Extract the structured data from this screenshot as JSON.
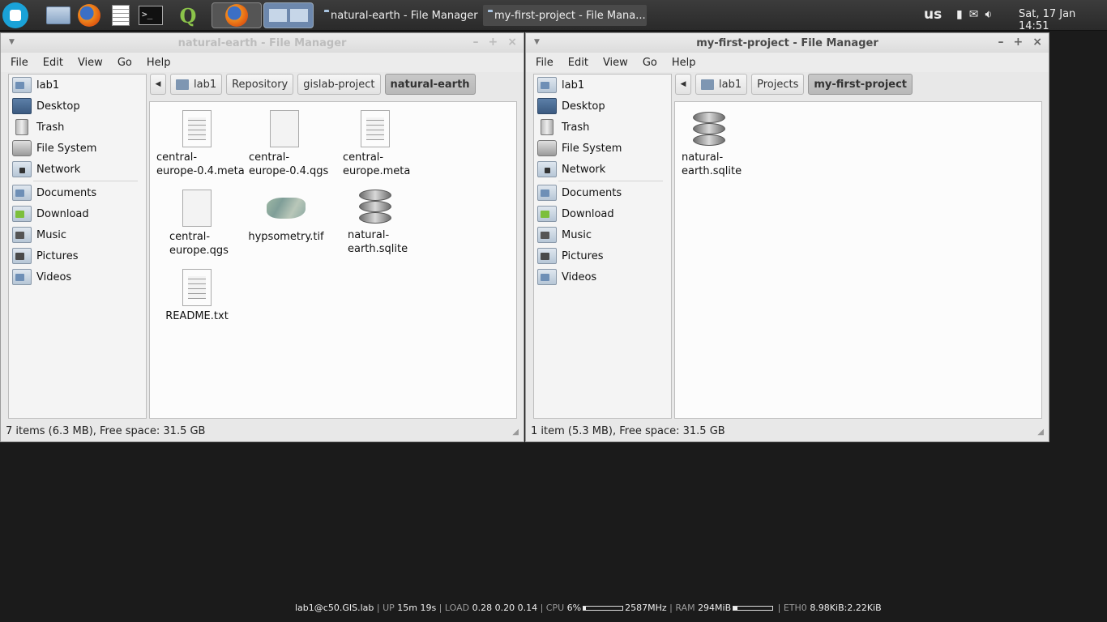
{
  "panel": {
    "tasks": [
      {
        "label": "natural-earth - File Manager"
      },
      {
        "label": "my-first-project - File Mana..."
      }
    ],
    "keyboard_layout": "us",
    "clock": "Sat, 17 Jan  14:51"
  },
  "windows": [
    {
      "title": "natural-earth - File Manager",
      "menu": [
        "File",
        "Edit",
        "View",
        "Go",
        "Help"
      ],
      "sidebar": {
        "places": [
          "lab1",
          "Desktop",
          "Trash",
          "File System",
          "Network"
        ],
        "bookmarks": [
          "Documents",
          "Download",
          "Music",
          "Pictures",
          "Videos"
        ]
      },
      "path": [
        "lab1",
        "Repository",
        "gislab-project",
        "natural-earth"
      ],
      "files": [
        {
          "name": "central-\neurope-0.4.meta"
        },
        {
          "name": "central-\neurope-0.4.qgs"
        },
        {
          "name": "central-\neurope.meta"
        },
        {
          "name": "central-\neurope.qgs"
        },
        {
          "name": "hypsometry.tif"
        },
        {
          "name": "natural-\nearth.sqlite"
        },
        {
          "name": "README.txt"
        }
      ],
      "status": "7 items (6.3 MB), Free space: 31.5 GB"
    },
    {
      "title": "my-first-project - File Manager",
      "menu": [
        "File",
        "Edit",
        "View",
        "Go",
        "Help"
      ],
      "sidebar": {
        "places": [
          "lab1",
          "Desktop",
          "Trash",
          "File System",
          "Network"
        ],
        "bookmarks": [
          "Documents",
          "Download",
          "Music",
          "Pictures",
          "Videos"
        ]
      },
      "path": [
        "lab1",
        "Projects",
        "my-first-project"
      ],
      "files": [
        {
          "name": "natural-\nearth.sqlite"
        }
      ],
      "status": "1 item (5.3 MB), Free space: 31.5 GB"
    }
  ],
  "sysinfo": {
    "host": "lab1@c50.GIS.lab",
    "up_label": "UP",
    "uptime": "15m 19s",
    "load_label": "LOAD",
    "load": "0.28 0.20 0.14",
    "cpu_label": "CPU",
    "cpu": "6%",
    "cpu_level": 0.06,
    "freq": "2587MHz",
    "ram_label": "RAM",
    "ram": "294MiB",
    "ram_level": 0.1,
    "eth_label": "ETH0",
    "eth": "8.98KiB:2.22KiB"
  }
}
